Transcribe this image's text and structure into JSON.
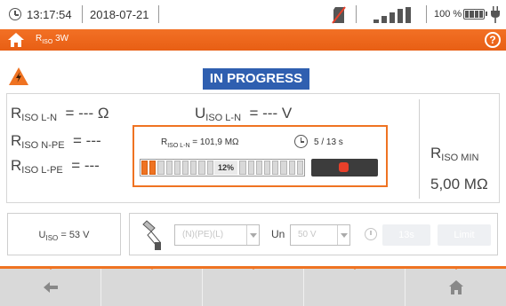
{
  "status_bar": {
    "time": "13:17:54",
    "date": "2018-07-21",
    "battery_percent": "100 %",
    "icons": [
      "clock-icon",
      "sd-card-missing-icon",
      "signal-icon",
      "battery-icon",
      "plug-icon"
    ]
  },
  "title_bar": {
    "title_main": "R",
    "title_sub": "ISO",
    "title_rest": " 3W",
    "accent_color": "#ef7322"
  },
  "status": {
    "label": "IN PROGRESS",
    "color": "#2f5fb0"
  },
  "measurements": {
    "riso_ln": {
      "sym": "R",
      "sub": "ISO L-N",
      "value": "= --- Ω"
    },
    "uiso_ln": {
      "sym": "U",
      "sub": "ISO L-N",
      "value": "= --- V"
    },
    "riso_npe": {
      "sym": "R",
      "sub": "ISO N-PE",
      "value": "= ---"
    },
    "riso_lpe": {
      "sym": "R",
      "sub": "ISO L-PE",
      "value": "= ---"
    },
    "riso_min": {
      "sym": "R",
      "sub": "ISO MIN",
      "value": "5,00 MΩ"
    }
  },
  "progress_popup": {
    "reading_sym": "R",
    "reading_sub": "ISO L-N",
    "reading_value": " = 101,9 MΩ",
    "time": "5 / 13 s",
    "percent_label": "12%",
    "progress": 0.12
  },
  "settings": {
    "uiso_sym": "U",
    "uiso_sub": "ISO",
    "uiso_value": " = 53 V",
    "conductor_select": "(N)(PE)(L)",
    "un_label": "Un",
    "un_value": "50 V",
    "time_button": "13s",
    "limit_button": "Limit"
  }
}
